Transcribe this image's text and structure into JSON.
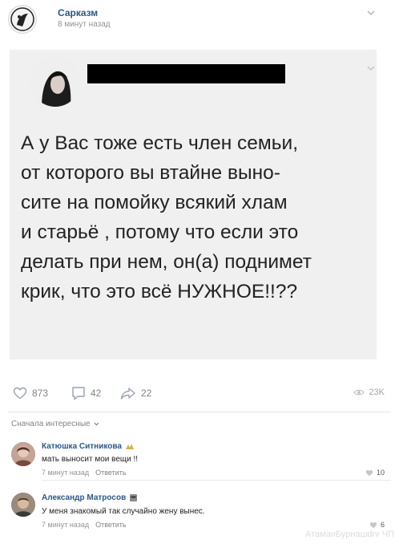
{
  "post": {
    "group_name": "Сарказм",
    "time": "8 минут назад",
    "quote_lines": [
      "А у Вас тоже есть член семьи,",
      "от которого вы втайне выно-",
      "сите на помойку всякий хлам",
      "и старьё , потому что если это",
      "делать при нем, он(а) поднимет",
      "крик, что это всё НУЖНОЕ!!??"
    ]
  },
  "actions": {
    "likes": "873",
    "comments": "42",
    "shares": "22",
    "views": "23K"
  },
  "comments_sort": "Сначала интересные",
  "comments": [
    {
      "author": "Катюшка Ситникова",
      "text": "мать выносит мои вещи !!",
      "time": "7 минут назад",
      "reply": "Ответить",
      "likes": "10"
    },
    {
      "author": "Александр Матросов",
      "text": "У меня знакомый так случайно жену вынес.",
      "time": "7 минут назад",
      "reply": "Ответить",
      "likes": "6"
    }
  ],
  "watermark": "АтаманБурнашdrv ЧП",
  "colors": {
    "link": "#2a5885",
    "card_bg": "#f0f0f0",
    "muted": "#939393"
  }
}
